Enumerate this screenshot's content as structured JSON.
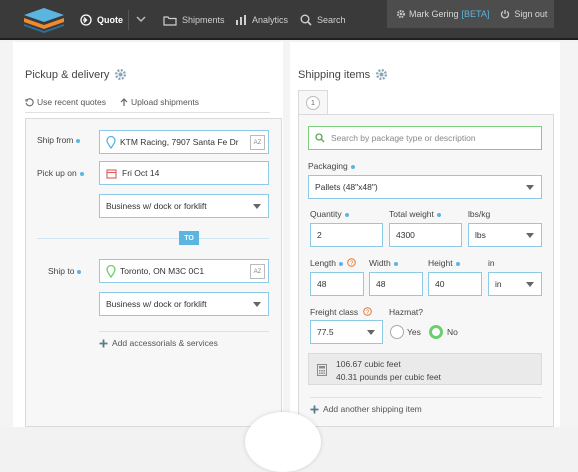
{
  "nav": {
    "quote": "Quote",
    "shipments": "Shipments",
    "analytics": "Analytics",
    "search": "Search"
  },
  "user": {
    "name": "Mark Gering",
    "beta": "[BETA]",
    "signout": "Sign out"
  },
  "pickup": {
    "title": "Pickup & delivery",
    "recent": "Use recent quotes",
    "upload": "Upload shipments",
    "ship_from_label": "Ship from",
    "ship_from_value": "KTM Racing, 7907 Santa Fe Dr",
    "pick_up_label": "Pick up on",
    "pick_up_value": "Fri Oct 14",
    "pickup_type": "Business w/ dock or forklift",
    "to_badge": "TO",
    "ship_to_label": "Ship to",
    "ship_to_value": "Toronto, ON M3C 0C1",
    "delivery_type": "Business w/ dock or forklift",
    "accessorials": "Add accessorials & services",
    "az": "AZ"
  },
  "items": {
    "title": "Shipping items",
    "tab": "1",
    "search_placeholder": "Search by package type or description",
    "packaging_label": "Packaging",
    "packaging_value": "Pallets (48\"x48\")",
    "quantity_label": "Quantity",
    "quantity_value": "2",
    "total_weight_label": "Total weight",
    "total_weight_value": "4300",
    "weight_unit_label": "lbs/kg",
    "weight_unit_value": "lbs",
    "length_label": "Length",
    "length_value": "48",
    "width_label": "Width",
    "width_value": "48",
    "height_label": "Height",
    "height_value": "40",
    "dim_unit_label": "in",
    "dim_unit_value": "in",
    "freight_class_label": "Freight class",
    "freight_class_value": "77.5",
    "hazmat_label": "Hazmat?",
    "hazmat_yes": "Yes",
    "hazmat_no": "No",
    "cubic_feet": "106.67 cubic feet",
    "density": "40.31 pounds per cubic feet",
    "add_item": "Add another shipping item"
  },
  "colors": {
    "accent": "#5ab6e0",
    "green": "#6bcf6b",
    "topbar": "#3a3a3a"
  }
}
